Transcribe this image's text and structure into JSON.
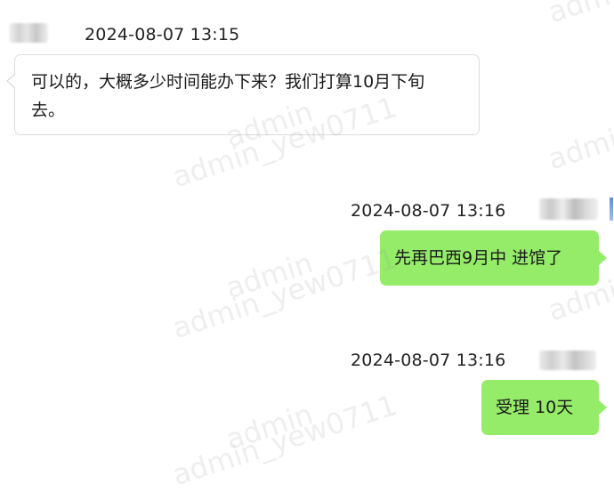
{
  "messages": [
    {
      "side": "left",
      "timestamp": "2024-08-07 13:15",
      "text_lines": [
        "可以的，大概多少时间能办下来？我们打算10月下旬",
        "去。"
      ]
    },
    {
      "side": "right",
      "timestamp": "2024-08-07 13:16",
      "text": "先再巴西9月中 进馆了"
    },
    {
      "side": "right",
      "timestamp": "2024-08-07 13:16",
      "text": "受理 10天"
    }
  ],
  "watermark": {
    "line1": "admin",
    "line2": "admin_yew0711"
  },
  "colors": {
    "outgoing_bubble": "#95ec69",
    "incoming_bubble": "#ffffff",
    "incoming_border": "#dcdcdc",
    "background": "#ffffff"
  }
}
